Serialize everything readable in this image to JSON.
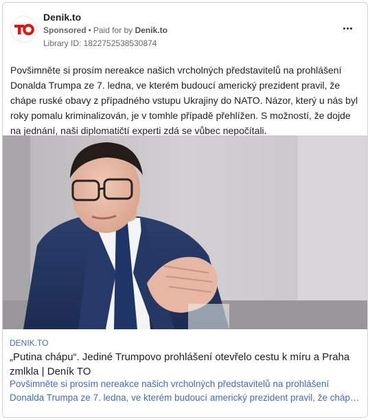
{
  "advertiser": {
    "name": "Denik.to",
    "logo_text": "TO",
    "logo_color": "#e3120b",
    "sponsored_label": "Sponsored",
    "paid_for_by_label": "Paid for by",
    "payer": "Denik.to",
    "library_id": "Library ID: 1822752538530874"
  },
  "menu": {
    "icon": "more-horizontal-icon"
  },
  "post": {
    "text": "Povšimněte si prosím nereakce našich vrcholných představitelů na prohlášení Donalda Trumpa ze 7. ledna, ve kterém budoucí americký prezident pravil, že chápe ruské obavy z případného vstupu Ukrajiny do NATO. Názor, který u nás byl roky pomalu kriminalizován, je v tomhle případě přehlížen. S možností, že dojde na jednání, naši diplomatičtí experti zdá se vůbec nepočítali."
  },
  "link": {
    "domain": "DENIK.TO",
    "title": "„Putina chápu“. Jediné Trumpovo prohlášení otevřelo cestu k míru a Praha zmlkla | Deník TO",
    "description_line1": "Povšimněte si prosím nereakce našich vrcholných představitelů na prohlášení",
    "description_line2": "Donalda Trumpa ze 7. ledna, ve kterém budoucí americký prezident pravil, že chápe ruské obavy z případného vstupu Ukrajiny do NATO."
  }
}
